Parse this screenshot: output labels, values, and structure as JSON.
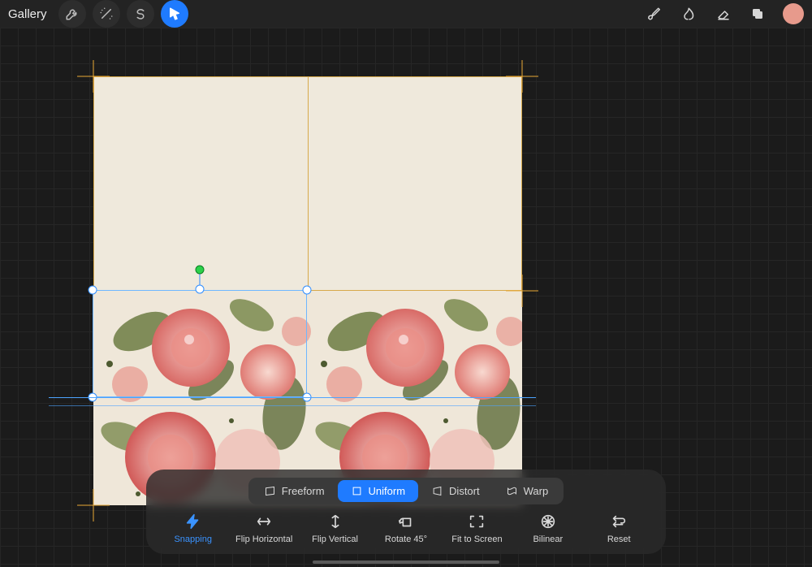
{
  "header": {
    "gallery_label": "Gallery"
  },
  "colors": {
    "accent": "#1f7bff",
    "current_color": "#e79a8c",
    "canvas_bg": "#efe9dc",
    "snap_guide": "#e8a836"
  },
  "transform": {
    "modes": [
      {
        "id": "freeform",
        "label": "Freeform",
        "active": false
      },
      {
        "id": "uniform",
        "label": "Uniform",
        "active": true
      },
      {
        "id": "distort",
        "label": "Distort",
        "active": false
      },
      {
        "id": "warp",
        "label": "Warp",
        "active": false
      }
    ],
    "actions": {
      "snapping": {
        "label": "Snapping",
        "active": true
      },
      "flip_horizontal": {
        "label": "Flip Horizontal",
        "active": false
      },
      "flip_vertical": {
        "label": "Flip Vertical",
        "active": false
      },
      "rotate_45": {
        "label": "Rotate 45°",
        "active": false
      },
      "fit_to_screen": {
        "label": "Fit to Screen",
        "active": false
      },
      "bilinear": {
        "label": "Bilinear",
        "active": false
      },
      "reset": {
        "label": "Reset",
        "active": false
      }
    }
  }
}
